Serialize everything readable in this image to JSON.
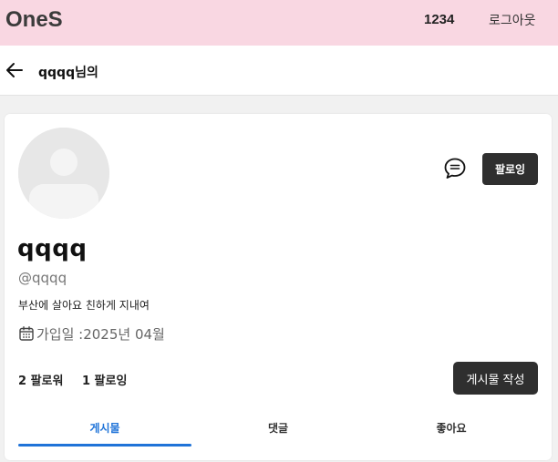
{
  "header": {
    "brand": "OneS",
    "user_number": "1234",
    "logout_label": "로그아웃"
  },
  "subheader": {
    "title": "qqqq님의"
  },
  "profile": {
    "display_name": "qqqq",
    "handle": "@qqqq",
    "bio": "부산에 살아요 친하게 지내여",
    "joined": "가입일 :2025년 04월",
    "follow_label": "팔로잉",
    "followers": "2 팔로워",
    "following": "1 팔로잉",
    "write_post_label": "게시물 작성"
  },
  "tabs": [
    {
      "label": "게시물",
      "active": true
    },
    {
      "label": "댓글",
      "active": false
    },
    {
      "label": "좋아요",
      "active": false
    }
  ],
  "colors": {
    "header_bg": "#f9d7e2",
    "accent": "#1f73d8",
    "button_dark": "#2f2f2f"
  },
  "icons": {
    "back": "arrow-left-icon",
    "chat": "chat-bubble-icon",
    "calendar": "calendar-icon",
    "avatar": "default-avatar"
  }
}
